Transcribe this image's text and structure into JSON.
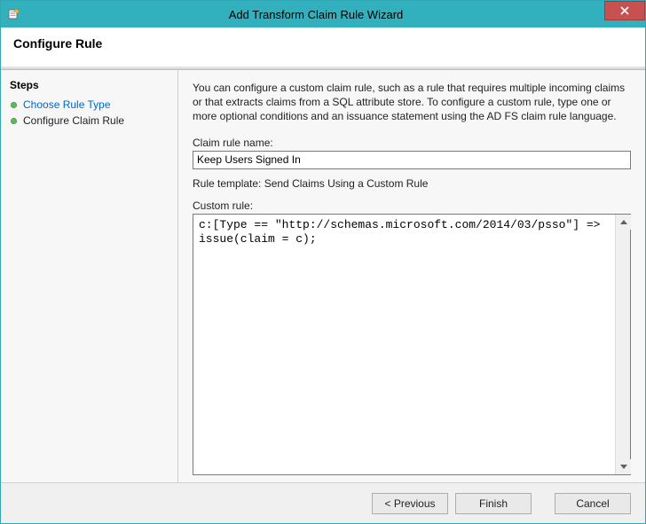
{
  "window": {
    "title": "Add Transform Claim Rule Wizard",
    "close_aria": "Close"
  },
  "header": {
    "title": "Configure Rule"
  },
  "sidebar": {
    "steps_label": "Steps",
    "items": [
      {
        "label": "Choose Rule Type",
        "is_current": false
      },
      {
        "label": "Configure Claim Rule",
        "is_current": true
      }
    ]
  },
  "main": {
    "description": "You can configure a custom claim rule, such as a rule that requires multiple incoming claims or that extracts claims from a SQL attribute store. To configure a custom rule, type one or more optional conditions and an issuance statement using the AD FS claim rule language.",
    "claim_rule_name_label": "Claim rule name:",
    "claim_rule_name_value": "Keep Users Signed In",
    "rule_template_line": "Rule template: Send Claims Using a Custom Rule",
    "custom_rule_label": "Custom rule:",
    "custom_rule_value": "c:[Type == \"http://schemas.microsoft.com/2014/03/psso\"] => issue(claim = c);"
  },
  "footer": {
    "previous": "< Previous",
    "finish": "Finish",
    "cancel": "Cancel"
  }
}
